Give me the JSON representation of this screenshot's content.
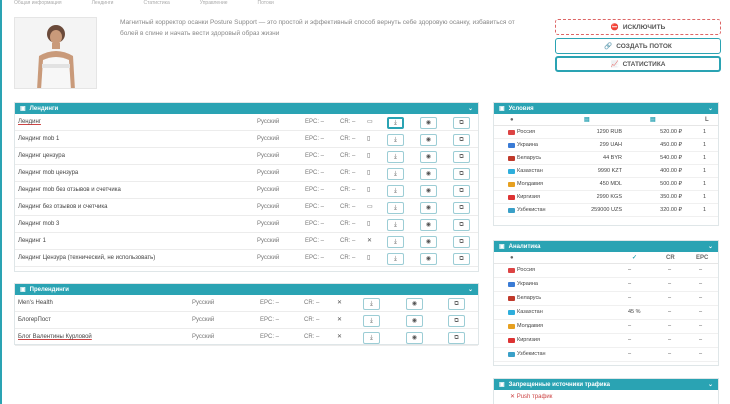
{
  "nav": [
    "Общая информация",
    "Лендинги",
    "Статистика",
    "Управление",
    "Потоки"
  ],
  "product": {
    "description": "Магнитный корректор осанки Posture Support — это простой и эффективный способ вернуть себе здоровую осанку, избавиться от болей в спине и начать вести здоровый образ жизни"
  },
  "actions": {
    "exclude": "ИСКЛЮЧИТЬ",
    "create_flow": "СОЗДАТЬ ПОТОК",
    "stats": "СТАТИСТИКА"
  },
  "landings": {
    "title": "Лендинги",
    "rows": [
      {
        "name": "Лендинг",
        "lang": "Русский",
        "epc": "EPC: –",
        "cr": "CR: –",
        "device": "desktop",
        "underline": true
      },
      {
        "name": "Лендинг mob 1",
        "lang": "Русский",
        "epc": "EPC: –",
        "cr": "CR: –",
        "device": "mobile"
      },
      {
        "name": "Лендинг цензура",
        "lang": "Русский",
        "epc": "EPC: –",
        "cr": "CR: –",
        "device": "mobile"
      },
      {
        "name": "Лендинг mob цензура",
        "lang": "Русский",
        "epc": "EPC: –",
        "cr": "CR: –",
        "device": "mobile"
      },
      {
        "name": "Лендинг mob без отзывов и счетчика",
        "lang": "Русский",
        "epc": "EPC: –",
        "cr": "CR: –",
        "device": "mobile"
      },
      {
        "name": "Лендинг без отзывов и счетчика",
        "lang": "Русский",
        "epc": "EPC: –",
        "cr": "CR: –",
        "device": "desktop"
      },
      {
        "name": "Лендинг mob 3",
        "lang": "Русский",
        "epc": "EPC: –",
        "cr": "CR: –",
        "device": "mobile"
      },
      {
        "name": "Лендинг 1",
        "lang": "Русский",
        "epc": "EPC: –",
        "cr": "CR: –",
        "device": "all"
      },
      {
        "name": "Лендинг Цензура (технический, не использовать)",
        "lang": "Русский",
        "epc": "EPC: –",
        "cr": "CR: –",
        "device": "mobile"
      }
    ]
  },
  "prelandings": {
    "title": "Прелендинги",
    "rows": [
      {
        "name": "Men's Health",
        "lang": "Русский",
        "epc": "EPC: –",
        "cr": "CR: –"
      },
      {
        "name": "БлогерПост",
        "lang": "Русский",
        "epc": "EPC: –",
        "cr": "CR: –"
      },
      {
        "name": "Блог Валентины Курловой",
        "lang": "Русский",
        "epc": "EPC: –",
        "cr": "CR: –",
        "underline": true
      }
    ]
  },
  "conditions": {
    "title": "Условия",
    "rows": [
      {
        "country": "Россия",
        "price": "1290 RUB",
        "payout": "520.00 ₽",
        "n": "1",
        "flag": "#d44"
      },
      {
        "country": "Украина",
        "price": "299 UAH",
        "payout": "450.00 ₽",
        "n": "1",
        "flag": "#3a7bd5"
      },
      {
        "country": "Беларусь",
        "price": "44 BYR",
        "payout": "540.00 ₽",
        "n": "1",
        "flag": "#c0392b"
      },
      {
        "country": "Казахстан",
        "price": "9990 KZT",
        "payout": "400.00 ₽",
        "n": "1",
        "flag": "#2eaedc"
      },
      {
        "country": "Молдавия",
        "price": "450 MDL",
        "payout": "500.00 ₽",
        "n": "1",
        "flag": "#e6a020"
      },
      {
        "country": "Киргизия",
        "price": "2990 KGS",
        "payout": "350.00 ₽",
        "n": "1",
        "flag": "#d33"
      },
      {
        "country": "Узбекистан",
        "price": "259000 UZS",
        "payout": "320.00 ₽",
        "n": "1",
        "flag": "#3aa0c8"
      }
    ]
  },
  "analytics": {
    "title": "Аналитика",
    "col_cr": "CR",
    "col_epc": "EPC",
    "rows": [
      {
        "country": "Россия",
        "a": "–",
        "cr": "–",
        "epc": "–",
        "flag": "#d44"
      },
      {
        "country": "Украина",
        "a": "–",
        "cr": "–",
        "epc": "–",
        "flag": "#3a7bd5"
      },
      {
        "country": "Беларусь",
        "a": "–",
        "cr": "–",
        "epc": "–",
        "flag": "#c0392b"
      },
      {
        "country": "Казахстан",
        "a": "45 %",
        "cr": "–",
        "epc": "–",
        "flag": "#2eaedc"
      },
      {
        "country": "Молдавия",
        "a": "–",
        "cr": "–",
        "epc": "–",
        "flag": "#e6a020"
      },
      {
        "country": "Киргизия",
        "a": "–",
        "cr": "–",
        "epc": "–",
        "flag": "#d33"
      },
      {
        "country": "Узбекистан",
        "a": "–",
        "cr": "–",
        "epc": "–",
        "flag": "#3aa0c8"
      }
    ]
  },
  "banned": {
    "title": "Запрещенные источники трафика",
    "first": "Push трафик"
  },
  "colors": {
    "accent": "#2aa3b3",
    "danger": "#cc4444"
  }
}
